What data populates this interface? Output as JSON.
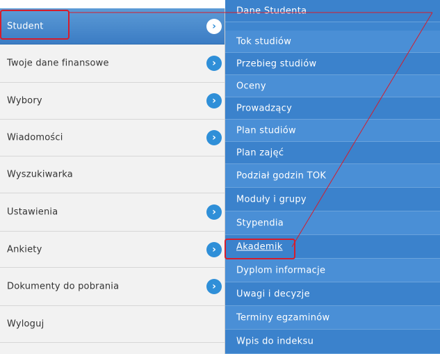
{
  "left_menu": [
    {
      "label": "Student",
      "active": true,
      "arrow": true
    },
    {
      "label": "Twoje dane finansowe",
      "active": false,
      "arrow": true
    },
    {
      "label": "Wybory",
      "active": false,
      "arrow": true
    },
    {
      "label": "Wiadomości",
      "active": false,
      "arrow": true
    },
    {
      "label": "Wyszukiwarka",
      "active": false,
      "arrow": false
    },
    {
      "label": "Ustawienia",
      "active": false,
      "arrow": true
    },
    {
      "label": "Ankiety",
      "active": false,
      "arrow": true
    },
    {
      "label": "Dokumenty do pobrania",
      "active": false,
      "arrow": true
    },
    {
      "label": "Wyloguj",
      "active": false,
      "arrow": false
    }
  ],
  "submenu": [
    "Dane Studenta",
    "Tok studiów",
    "Przebieg studiów",
    "Oceny",
    "Prowadzący",
    "Plan studiów",
    "Plan zajęć",
    "Podział godzin TOK",
    "Moduły i grupy",
    "Stypendia",
    "Akademik",
    "Dyplom informacje",
    "Uwagi i decyzje",
    "Terminy egzaminów",
    "Wpis do indeksu"
  ],
  "selected_submenu": "Akademik",
  "arrow_glyph": "›",
  "colors": {
    "accent": "#3f86cf",
    "highlight": "#d61c2b"
  }
}
